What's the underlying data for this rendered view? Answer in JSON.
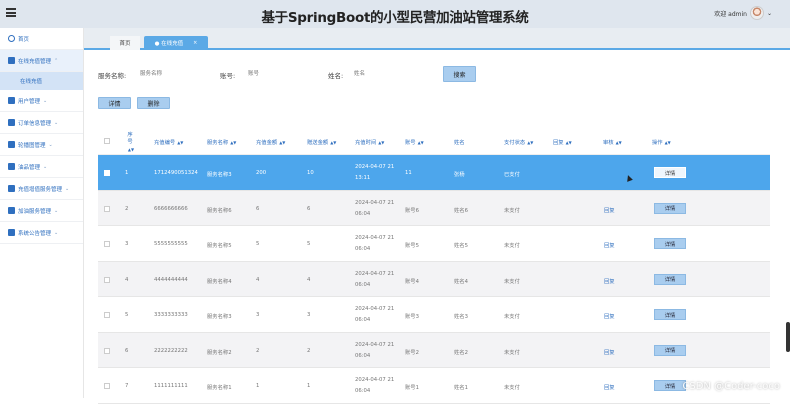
{
  "app": {
    "title": "基于SpringBoot的小型民营加油站管理系统",
    "welcome": "欢迎 admin"
  },
  "sidebar": {
    "items": [
      {
        "label": "首页",
        "icon": "home-icon"
      },
      {
        "label": "在线充值管理",
        "icon": "wallet-icon",
        "sub": [
          "在线充值"
        ]
      },
      {
        "label": "用户管理",
        "icon": "user-icon"
      },
      {
        "label": "订单信息管理",
        "icon": "order-icon"
      },
      {
        "label": "轮播图管理",
        "icon": "image-icon"
      },
      {
        "label": "油品管理",
        "icon": "oil-icon"
      },
      {
        "label": "充值增值服务管理",
        "icon": "service-icon"
      },
      {
        "label": "加油服务管理",
        "icon": "fuel-icon"
      },
      {
        "label": "系统公告管理",
        "icon": "notice-icon"
      }
    ]
  },
  "tabs": [
    {
      "label": "首页"
    },
    {
      "label": "● 在线充值"
    }
  ],
  "search": {
    "service_label": "服务名称:",
    "service_placeholder": "服务名称",
    "account_label": "账号:",
    "account_placeholder": "账号",
    "name_label": "姓名:",
    "name_placeholder": "姓名",
    "search_btn": "搜索"
  },
  "actions": {
    "detail": "详情",
    "delete": "删除"
  },
  "table": {
    "headers": [
      "序号",
      "充值编号",
      "服务名称",
      "充值金额",
      "赠送金额",
      "充值时间",
      "账号",
      "姓名",
      "支付状态",
      "回复",
      "审核",
      "操作"
    ],
    "rows": [
      {
        "idx": "1",
        "no": "1712490051324",
        "service": "服务名称3",
        "amount": "200",
        "gift": "10",
        "time1": "2024-04-07 21",
        "time2": "13:11",
        "account": "11",
        "name": "张杨",
        "pay": "已支付",
        "reply": "",
        "audit": "",
        "op": "详情"
      },
      {
        "idx": "2",
        "no": "6666666666",
        "service": "服务名称6",
        "amount": "6",
        "gift": "6",
        "time1": "2024-04-07 21",
        "time2": "06:04",
        "account": "账号6",
        "name": "姓名6",
        "pay": "未支付",
        "reply": "",
        "audit": "回复",
        "op": "详情"
      },
      {
        "idx": "3",
        "no": "5555555555",
        "service": "服务名称5",
        "amount": "5",
        "gift": "5",
        "time1": "2024-04-07 21",
        "time2": "06:04",
        "account": "账号5",
        "name": "姓名5",
        "pay": "未支付",
        "reply": "",
        "audit": "回复",
        "op": "详情"
      },
      {
        "idx": "4",
        "no": "4444444444",
        "service": "服务名称4",
        "amount": "4",
        "gift": "4",
        "time1": "2024-04-07 21",
        "time2": "06:04",
        "account": "账号4",
        "name": "姓名4",
        "pay": "未支付",
        "reply": "",
        "audit": "回复",
        "op": "详情"
      },
      {
        "idx": "5",
        "no": "3333333333",
        "service": "服务名称3",
        "amount": "3",
        "gift": "3",
        "time1": "2024-04-07 21",
        "time2": "06:04",
        "account": "账号3",
        "name": "姓名3",
        "pay": "未支付",
        "reply": "",
        "audit": "回复",
        "op": "详情"
      },
      {
        "idx": "6",
        "no": "2222222222",
        "service": "服务名称2",
        "amount": "2",
        "gift": "2",
        "time1": "2024-04-07 21",
        "time2": "06:04",
        "account": "账号2",
        "name": "姓名2",
        "pay": "未支付",
        "reply": "",
        "audit": "回复",
        "op": "详情"
      },
      {
        "idx": "7",
        "no": "1111111111",
        "service": "服务名称1",
        "amount": "1",
        "gift": "1",
        "time1": "2024-04-07 21",
        "time2": "06:04",
        "account": "账号1",
        "name": "姓名1",
        "pay": "未支付",
        "reply": "",
        "audit": "回复",
        "op": "详情"
      }
    ]
  },
  "watermark": "CSDN @Coder-coco",
  "colors": {
    "accent": "#4da6ec",
    "link": "#2f6fbf",
    "button": "#a9cdef"
  }
}
